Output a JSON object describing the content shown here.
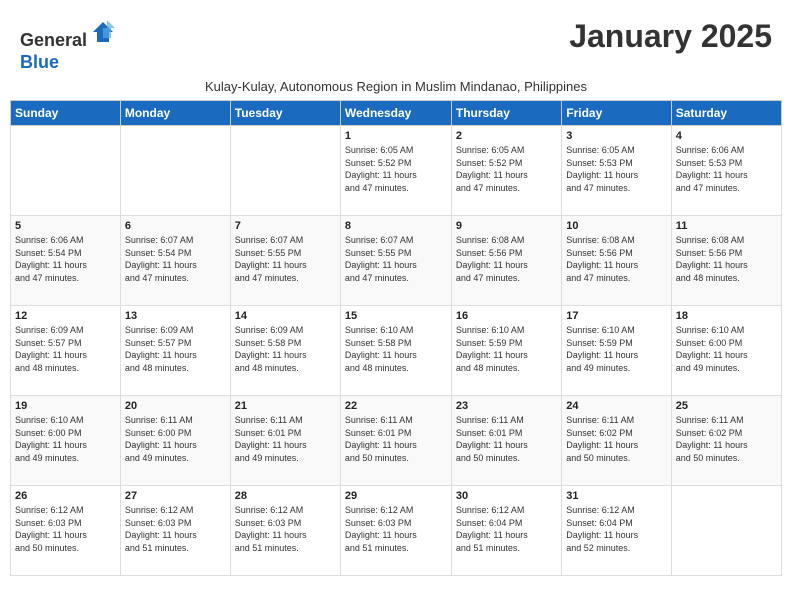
{
  "logo": {
    "general": "General",
    "blue": "Blue"
  },
  "title": "January 2025",
  "subtitle": "Kulay-Kulay, Autonomous Region in Muslim Mindanao, Philippines",
  "days_of_week": [
    "Sunday",
    "Monday",
    "Tuesday",
    "Wednesday",
    "Thursday",
    "Friday",
    "Saturday"
  ],
  "weeks": [
    [
      {
        "day": "",
        "info": ""
      },
      {
        "day": "",
        "info": ""
      },
      {
        "day": "",
        "info": ""
      },
      {
        "day": "1",
        "info": "Sunrise: 6:05 AM\nSunset: 5:52 PM\nDaylight: 11 hours\nand 47 minutes."
      },
      {
        "day": "2",
        "info": "Sunrise: 6:05 AM\nSunset: 5:52 PM\nDaylight: 11 hours\nand 47 minutes."
      },
      {
        "day": "3",
        "info": "Sunrise: 6:05 AM\nSunset: 5:53 PM\nDaylight: 11 hours\nand 47 minutes."
      },
      {
        "day": "4",
        "info": "Sunrise: 6:06 AM\nSunset: 5:53 PM\nDaylight: 11 hours\nand 47 minutes."
      }
    ],
    [
      {
        "day": "5",
        "info": "Sunrise: 6:06 AM\nSunset: 5:54 PM\nDaylight: 11 hours\nand 47 minutes."
      },
      {
        "day": "6",
        "info": "Sunrise: 6:07 AM\nSunset: 5:54 PM\nDaylight: 11 hours\nand 47 minutes."
      },
      {
        "day": "7",
        "info": "Sunrise: 6:07 AM\nSunset: 5:55 PM\nDaylight: 11 hours\nand 47 minutes."
      },
      {
        "day": "8",
        "info": "Sunrise: 6:07 AM\nSunset: 5:55 PM\nDaylight: 11 hours\nand 47 minutes."
      },
      {
        "day": "9",
        "info": "Sunrise: 6:08 AM\nSunset: 5:56 PM\nDaylight: 11 hours\nand 47 minutes."
      },
      {
        "day": "10",
        "info": "Sunrise: 6:08 AM\nSunset: 5:56 PM\nDaylight: 11 hours\nand 47 minutes."
      },
      {
        "day": "11",
        "info": "Sunrise: 6:08 AM\nSunset: 5:56 PM\nDaylight: 11 hours\nand 48 minutes."
      }
    ],
    [
      {
        "day": "12",
        "info": "Sunrise: 6:09 AM\nSunset: 5:57 PM\nDaylight: 11 hours\nand 48 minutes."
      },
      {
        "day": "13",
        "info": "Sunrise: 6:09 AM\nSunset: 5:57 PM\nDaylight: 11 hours\nand 48 minutes."
      },
      {
        "day": "14",
        "info": "Sunrise: 6:09 AM\nSunset: 5:58 PM\nDaylight: 11 hours\nand 48 minutes."
      },
      {
        "day": "15",
        "info": "Sunrise: 6:10 AM\nSunset: 5:58 PM\nDaylight: 11 hours\nand 48 minutes."
      },
      {
        "day": "16",
        "info": "Sunrise: 6:10 AM\nSunset: 5:59 PM\nDaylight: 11 hours\nand 48 minutes."
      },
      {
        "day": "17",
        "info": "Sunrise: 6:10 AM\nSunset: 5:59 PM\nDaylight: 11 hours\nand 49 minutes."
      },
      {
        "day": "18",
        "info": "Sunrise: 6:10 AM\nSunset: 6:00 PM\nDaylight: 11 hours\nand 49 minutes."
      }
    ],
    [
      {
        "day": "19",
        "info": "Sunrise: 6:10 AM\nSunset: 6:00 PM\nDaylight: 11 hours\nand 49 minutes."
      },
      {
        "day": "20",
        "info": "Sunrise: 6:11 AM\nSunset: 6:00 PM\nDaylight: 11 hours\nand 49 minutes."
      },
      {
        "day": "21",
        "info": "Sunrise: 6:11 AM\nSunset: 6:01 PM\nDaylight: 11 hours\nand 49 minutes."
      },
      {
        "day": "22",
        "info": "Sunrise: 6:11 AM\nSunset: 6:01 PM\nDaylight: 11 hours\nand 50 minutes."
      },
      {
        "day": "23",
        "info": "Sunrise: 6:11 AM\nSunset: 6:01 PM\nDaylight: 11 hours\nand 50 minutes."
      },
      {
        "day": "24",
        "info": "Sunrise: 6:11 AM\nSunset: 6:02 PM\nDaylight: 11 hours\nand 50 minutes."
      },
      {
        "day": "25",
        "info": "Sunrise: 6:11 AM\nSunset: 6:02 PM\nDaylight: 11 hours\nand 50 minutes."
      }
    ],
    [
      {
        "day": "26",
        "info": "Sunrise: 6:12 AM\nSunset: 6:03 PM\nDaylight: 11 hours\nand 50 minutes."
      },
      {
        "day": "27",
        "info": "Sunrise: 6:12 AM\nSunset: 6:03 PM\nDaylight: 11 hours\nand 51 minutes."
      },
      {
        "day": "28",
        "info": "Sunrise: 6:12 AM\nSunset: 6:03 PM\nDaylight: 11 hours\nand 51 minutes."
      },
      {
        "day": "29",
        "info": "Sunrise: 6:12 AM\nSunset: 6:03 PM\nDaylight: 11 hours\nand 51 minutes."
      },
      {
        "day": "30",
        "info": "Sunrise: 6:12 AM\nSunset: 6:04 PM\nDaylight: 11 hours\nand 51 minutes."
      },
      {
        "day": "31",
        "info": "Sunrise: 6:12 AM\nSunset: 6:04 PM\nDaylight: 11 hours\nand 52 minutes."
      },
      {
        "day": "",
        "info": ""
      }
    ]
  ]
}
